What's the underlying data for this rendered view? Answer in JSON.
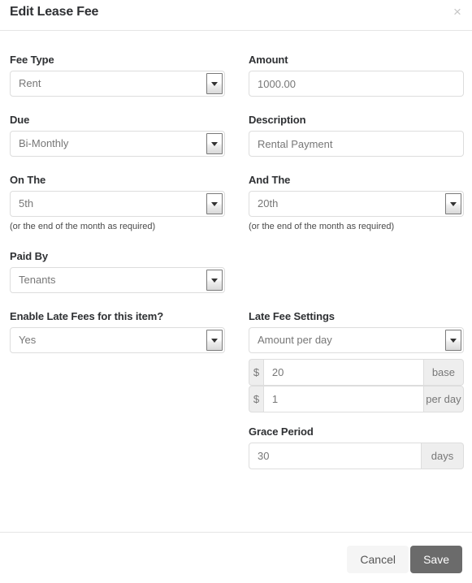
{
  "dialog": {
    "title": "Edit Lease Fee",
    "close_label": "×",
    "close_icon": "close-icon"
  },
  "fields": {
    "fee_type": {
      "label": "Fee Type",
      "value": "Rent"
    },
    "amount": {
      "label": "Amount",
      "value": "1000.00"
    },
    "due": {
      "label": "Due",
      "value": "Bi-Monthly"
    },
    "description": {
      "label": "Description",
      "value": "Rental Payment"
    },
    "on_the": {
      "label": "On The",
      "value": "5th",
      "hint": "(or the end of the month as required)"
    },
    "and_the": {
      "label": "And The",
      "value": "20th",
      "hint": "(or the end of the month as required)"
    },
    "paid_by": {
      "label": "Paid By",
      "value": "Tenants"
    },
    "enable_late_fees": {
      "label": "Enable Late Fees for this item?",
      "value": "Yes"
    },
    "late_fee_settings": {
      "label": "Late Fee Settings",
      "value": "Amount per day"
    },
    "late_fee_base": {
      "prefix": "$",
      "value": "20",
      "suffix": "base"
    },
    "late_fee_per_day": {
      "prefix": "$",
      "value": "1",
      "suffix": "per day"
    },
    "grace_period": {
      "label": "Grace Period",
      "value": "30",
      "suffix": "days"
    }
  },
  "footer": {
    "cancel_label": "Cancel",
    "save_label": "Save"
  },
  "colors": {
    "save_button": "#6b6b6b",
    "cancel_button": "#f5f5f5",
    "label_text": "#2e3033",
    "value_text": "#777777",
    "border": "#dddddd",
    "addon_background": "#eeeeee"
  }
}
